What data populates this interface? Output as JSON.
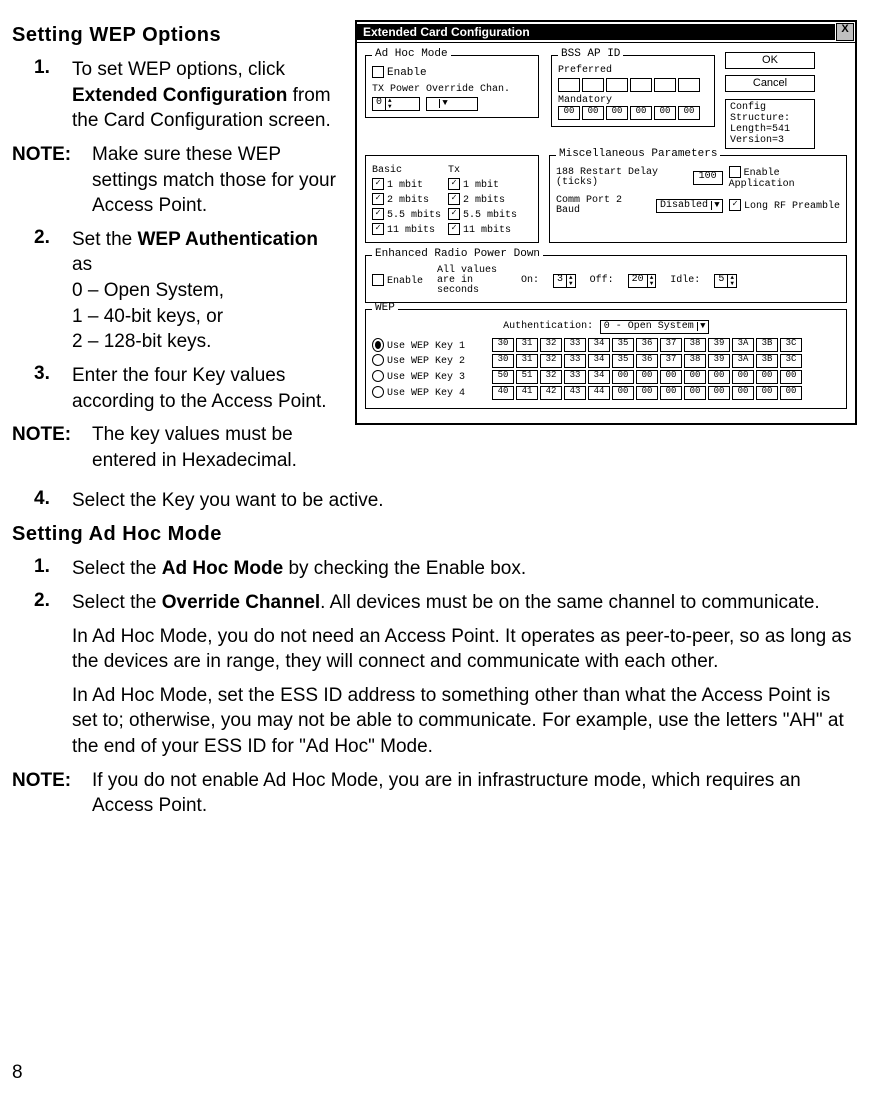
{
  "page_number": "8",
  "headings": {
    "wep": "Setting WEP Options",
    "adhoc": "Setting Ad Hoc Mode"
  },
  "wep_steps": {
    "s1": {
      "n": "1.",
      "t1": "To set WEP options, click ",
      "b": "Extended Configuration",
      "t2": " from the Card Configuration screen."
    },
    "note1": {
      "lbl": "NOTE:",
      "t": "Make sure these WEP settings match those for your Access Point."
    },
    "s2": {
      "n": "2.",
      "t1": "Set the ",
      "b": "WEP Authentication",
      "t2": " as",
      "l0": "0 – Open System,",
      "l1": "1 – 40-bit keys, or",
      "l2": "2 – 128-bit keys."
    },
    "s3": {
      "n": "3.",
      "t": "Enter the four Key values according to the Access Point."
    },
    "note2": {
      "lbl": "NOTE:",
      "t": "The key values must be entered in Hexadecimal."
    },
    "s4": {
      "n": "4.",
      "t": "Select the Key you want to be active."
    }
  },
  "adhoc_steps": {
    "s1": {
      "n": "1.",
      "t1": "Select the ",
      "b": "Ad Hoc Mode",
      "t2": " by checking the Enable box."
    },
    "s2": {
      "n": "2.",
      "t1": "Select the ",
      "b": "Override Channel",
      "t2": ".  All devices must be on the same channel to communicate."
    },
    "p1": "In Ad Hoc Mode, you do not need an Access Point.  It operates as peer-to-peer, so as long as the devices are in range, they will connect and communicate with each other.",
    "p2": "In Ad Hoc Mode, set the ESS ID address to something other than what the Access Point is set to; otherwise, you may not be able to communicate.  For example, use the letters \"AH\" at the end of your ESS ID for \"Ad Hoc\" Mode.",
    "note": {
      "lbl": "NOTE:",
      "t": "If you do not enable Ad Hoc Mode, you are in infrastructure mode, which requires an Access Point."
    }
  },
  "dialog": {
    "title": "Extended Card Configuration",
    "close": "X",
    "ok": "OK",
    "cancel": "Cancel",
    "config_struct": {
      "l1": "Config Structure:",
      "l2": "Length=541",
      "l3": "Version=3"
    },
    "adhoc": {
      "title": "Ad Hoc Mode",
      "enable": "Enable",
      "txpower": "TX Power",
      "txval": "0",
      "override": "Override Chan."
    },
    "bss": {
      "title": "BSS AP ID",
      "pref": "Preferred",
      "mand": "Mandatory",
      "cells": [
        "00",
        "00",
        "00",
        "00",
        "00",
        "00"
      ]
    },
    "rates": {
      "basic": "Basic",
      "tx": "Tx",
      "r": [
        "1 mbit",
        "2 mbits",
        "5.5 mbits",
        "11 mbits"
      ]
    },
    "misc": {
      "title": "Miscellaneous Parameters",
      "restart": "188 Restart Delay (ticks)",
      "restart_v": "100",
      "comm": "Comm Port 2 Baud",
      "comm_v": "Disabled",
      "enapp": "Enable Application",
      "preamble": "Long RF Preamble"
    },
    "power": {
      "title": "Enhanced Radio Power Down",
      "enable": "Enable",
      "note": "All values are in seconds",
      "on": "On:",
      "on_v": "3",
      "off": "Off:",
      "off_v": "20",
      "idle": "Idle:",
      "idle_v": "5"
    },
    "wep": {
      "title": "WEP",
      "auth_lbl": "Authentication:",
      "auth_v": "0 - Open System",
      "keys": [
        {
          "lbl": "Use WEP Key 1",
          "v": [
            "30",
            "31",
            "32",
            "33",
            "34",
            "35",
            "36",
            "37",
            "38",
            "39",
            "3A",
            "3B",
            "3C"
          ]
        },
        {
          "lbl": "Use WEP Key 2",
          "v": [
            "30",
            "31",
            "32",
            "33",
            "34",
            "35",
            "36",
            "37",
            "38",
            "39",
            "3A",
            "3B",
            "3C"
          ]
        },
        {
          "lbl": "Use WEP Key 3",
          "v": [
            "50",
            "51",
            "32",
            "33",
            "34",
            "00",
            "00",
            "00",
            "00",
            "00",
            "00",
            "00",
            "00"
          ]
        },
        {
          "lbl": "Use WEP Key 4",
          "v": [
            "40",
            "41",
            "42",
            "43",
            "44",
            "00",
            "00",
            "00",
            "00",
            "00",
            "00",
            "00",
            "00"
          ]
        }
      ]
    }
  }
}
